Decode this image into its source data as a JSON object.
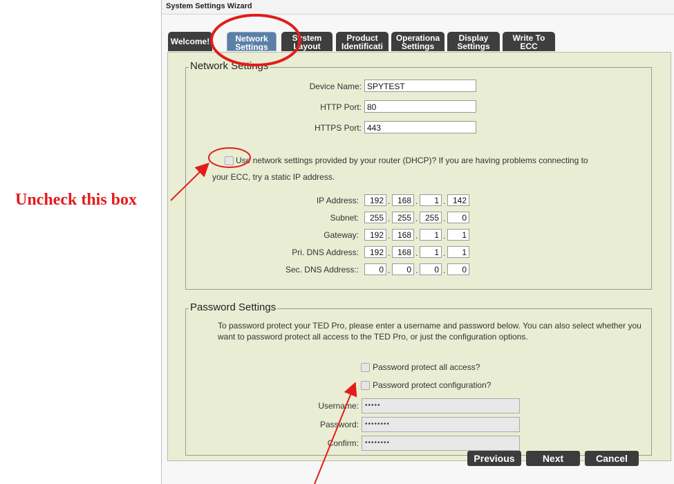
{
  "window": {
    "title": "System Settings Wizard"
  },
  "tabs": [
    {
      "line1": "Welcome!",
      "line2": ""
    },
    {
      "line1": "Network",
      "line2": "Settings"
    },
    {
      "line1": "System",
      "line2": "Layout"
    },
    {
      "line1": "Product",
      "line2": "Identificati"
    },
    {
      "line1": "Operationa",
      "line2": "Settings"
    },
    {
      "line1": "Display",
      "line2": "Settings"
    },
    {
      "line1": "Write To",
      "line2": "ECC"
    }
  ],
  "network": {
    "legend": "Network Settings",
    "device_name_label": "Device Name:",
    "device_name": "SPYTEST",
    "http_port_label": "HTTP Port:",
    "http_port": "80",
    "https_port_label": "HTTPS Port:",
    "https_port": "443",
    "dhcp_text_line1": "Use network settings provided by your router (DHCP)? If you are having problems connecting to",
    "dhcp_text_line2": "your ECC, try a static IP address.",
    "ip_label": "IP Address:",
    "ip": [
      "192",
      "168",
      "1",
      "142"
    ],
    "subnet_label": "Subnet:",
    "subnet": [
      "255",
      "255",
      "255",
      "0"
    ],
    "gateway_label": "Gateway:",
    "gateway": [
      "192",
      "168",
      "1",
      "1"
    ],
    "pri_dns_label": "Pri. DNS Address:",
    "pri_dns": [
      "192",
      "168",
      "1",
      "1"
    ],
    "sec_dns_label": "Sec. DNS Address::",
    "sec_dns": [
      "0",
      "0",
      "0",
      "0"
    ]
  },
  "password": {
    "legend": "Password Settings",
    "description": "To password protect your TED Pro, please enter a username and password below. You can also select whether you want to password protect all access to the TED Pro, or just the configuration options.",
    "protect_all_label": "Password protect all access?",
    "protect_config_label": "Password protect configuration?",
    "username_label": "Username:",
    "username_value": "•••••",
    "password_label": "Password:",
    "password_value": "••••••••",
    "confirm_label": "Confirm:",
    "confirm_value": "••••••••"
  },
  "buttons": {
    "previous": "Previous",
    "next": "Next",
    "cancel": "Cancel"
  },
  "annotation": {
    "text": "Uncheck this box",
    "color": "#e31b1b"
  }
}
